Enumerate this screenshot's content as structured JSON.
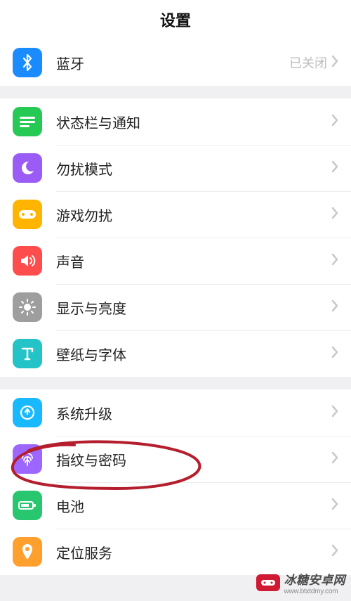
{
  "header": {
    "title": "设置"
  },
  "groups": [
    {
      "items": [
        {
          "id": "bluetooth",
          "label": "蓝牙",
          "status": "已关闭",
          "icon": "bluetooth-icon",
          "color": "#1b8cff"
        }
      ]
    },
    {
      "items": [
        {
          "id": "status-bar",
          "label": "状态栏与通知",
          "icon": "status-bar-icon",
          "color": "#27c955"
        },
        {
          "id": "dnd",
          "label": "勿扰模式",
          "icon": "moon-icon",
          "color": "#9b5cf6"
        },
        {
          "id": "game-dnd",
          "label": "游戏勿扰",
          "icon": "gamepad-icon",
          "color": "#ffb400"
        },
        {
          "id": "sound",
          "label": "声音",
          "icon": "sound-icon",
          "color": "#ff4d4d"
        },
        {
          "id": "display",
          "label": "显示与亮度",
          "icon": "brightness-icon",
          "color": "#9e9e9e"
        },
        {
          "id": "wallpaper",
          "label": "壁纸与字体",
          "icon": "text-icon",
          "color": "#23c3c7"
        }
      ]
    },
    {
      "items": [
        {
          "id": "system-update",
          "label": "系统升级",
          "icon": "update-icon",
          "color": "#19b9ff"
        },
        {
          "id": "fingerprint",
          "label": "指纹与密码",
          "icon": "fingerprint-icon",
          "color": "#9d67ff",
          "circled": true
        },
        {
          "id": "battery",
          "label": "电池",
          "icon": "battery-icon",
          "color": "#28c76f"
        },
        {
          "id": "location",
          "label": "定位服务",
          "icon": "location-icon",
          "color": "#ff9f2d"
        }
      ]
    }
  ],
  "watermark": {
    "brand": "冰糖安卓网",
    "url": "www.btxtdmy.com"
  },
  "annotation": {
    "circle_color": "#b41e2d"
  }
}
